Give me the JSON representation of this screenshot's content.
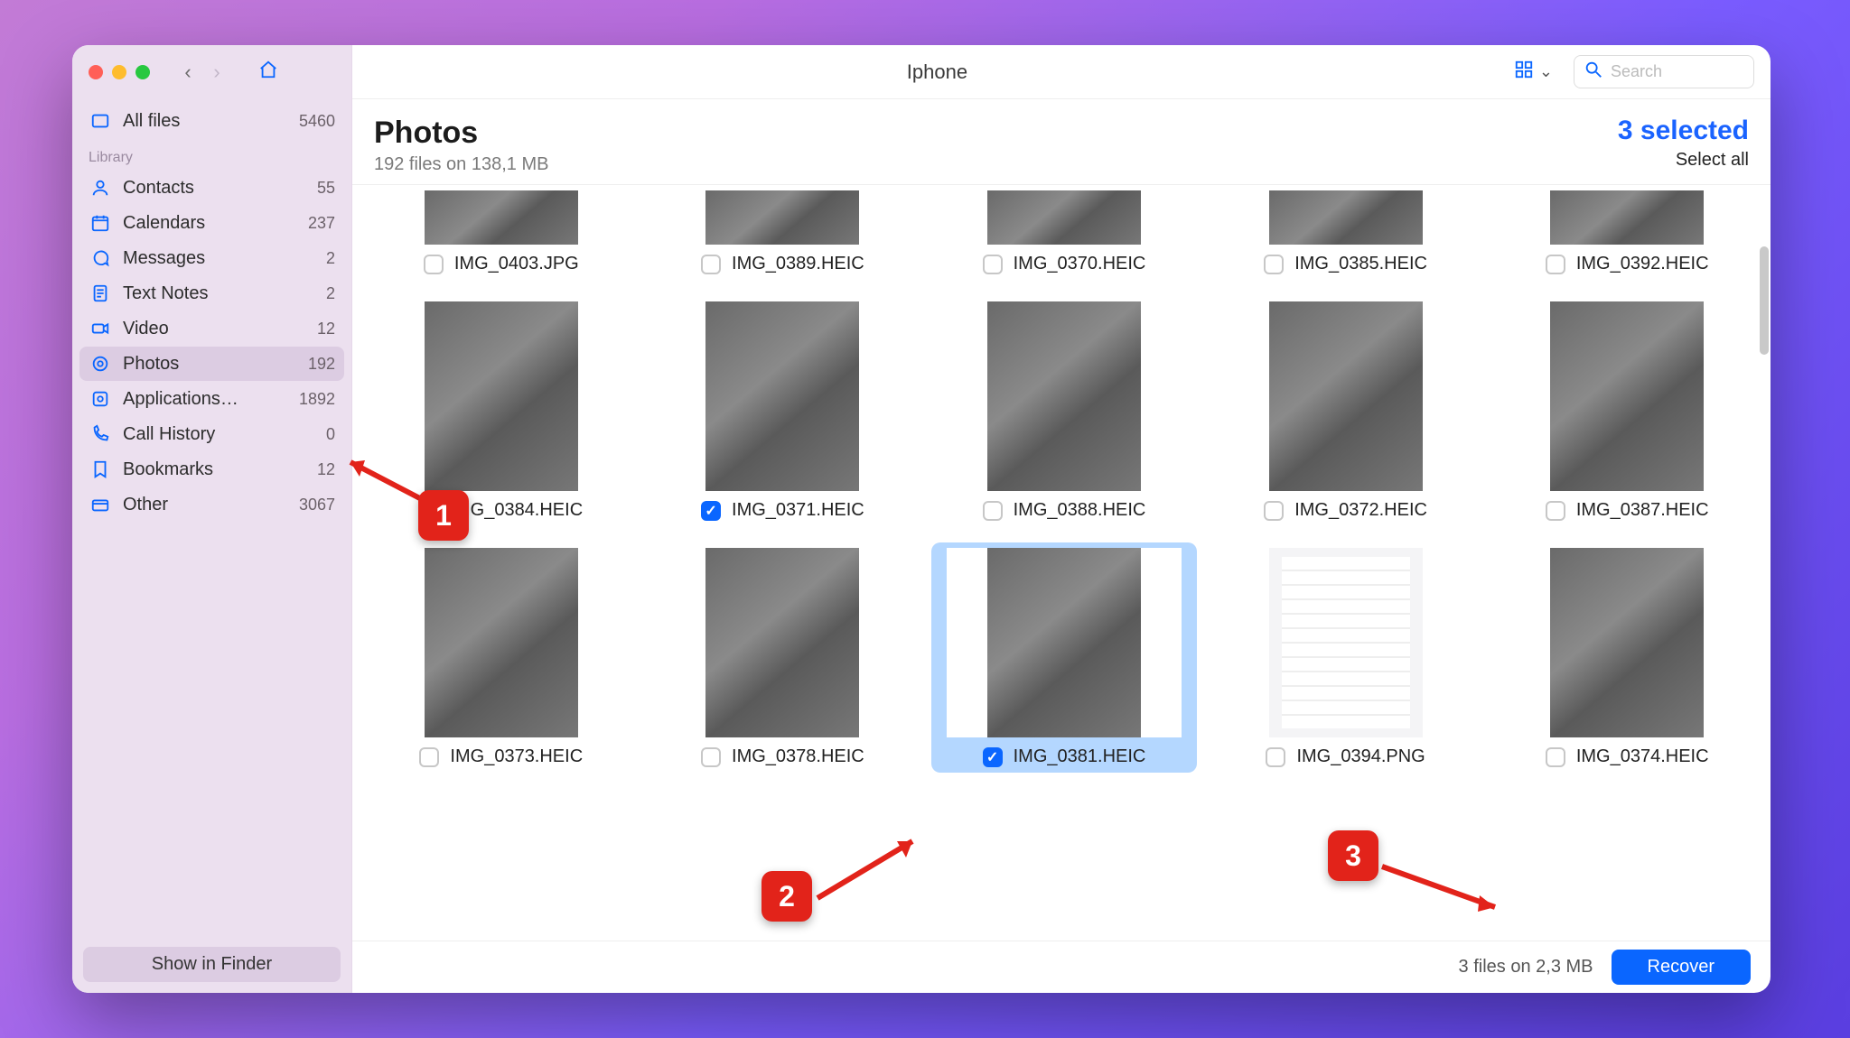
{
  "window": {
    "title": "Iphone"
  },
  "search": {
    "placeholder": "Search"
  },
  "sidebar": {
    "top": {
      "label": "All files",
      "count": "5460"
    },
    "section_label": "Library",
    "items": [
      {
        "icon": "contacts-icon",
        "label": "Contacts",
        "count": "55"
      },
      {
        "icon": "calendar-icon",
        "label": "Calendars",
        "count": "237"
      },
      {
        "icon": "messages-icon",
        "label": "Messages",
        "count": "2"
      },
      {
        "icon": "notes-icon",
        "label": "Text Notes",
        "count": "2"
      },
      {
        "icon": "video-icon",
        "label": "Video",
        "count": "12"
      },
      {
        "icon": "photos-icon",
        "label": "Photos",
        "count": "192",
        "selected": true
      },
      {
        "icon": "apps-icon",
        "label": "Applications…",
        "count": "1892"
      },
      {
        "icon": "phone-icon",
        "label": "Call History",
        "count": "0"
      },
      {
        "icon": "bookmark-icon",
        "label": "Bookmarks",
        "count": "12"
      },
      {
        "icon": "other-icon",
        "label": "Other",
        "count": "3067"
      }
    ],
    "footer_button": "Show in Finder"
  },
  "header": {
    "title": "Photos",
    "subtitle": "192 files on 138,1 MB",
    "selected_text": "3 selected",
    "select_all": "Select all"
  },
  "grid": {
    "rows": [
      [
        {
          "name": "IMG_0403.JPG",
          "checked": false
        },
        {
          "name": "IMG_0389.HEIC",
          "checked": false
        },
        {
          "name": "IMG_0370.HEIC",
          "checked": false
        },
        {
          "name": "IMG_0385.HEIC",
          "checked": false
        },
        {
          "name": "IMG_0392.HEIC",
          "checked": false
        }
      ],
      [
        {
          "name": "IMG_0384.HEIC",
          "checked": true
        },
        {
          "name": "IMG_0371.HEIC",
          "checked": true
        },
        {
          "name": "IMG_0388.HEIC",
          "checked": false
        },
        {
          "name": "IMG_0372.HEIC",
          "checked": false
        },
        {
          "name": "IMG_0387.HEIC",
          "checked": false
        }
      ],
      [
        {
          "name": "IMG_0373.HEIC",
          "checked": false
        },
        {
          "name": "IMG_0378.HEIC",
          "checked": false
        },
        {
          "name": "IMG_0381.HEIC",
          "checked": true,
          "highlight": true
        },
        {
          "name": "IMG_0394.PNG",
          "checked": false,
          "screenshot": true
        },
        {
          "name": "IMG_0374.HEIC",
          "checked": false
        }
      ]
    ]
  },
  "footer": {
    "status": "3 files on 2,3 MB",
    "recover": "Recover"
  },
  "annotations": {
    "badge1": "1",
    "badge2": "2",
    "badge3": "3"
  }
}
